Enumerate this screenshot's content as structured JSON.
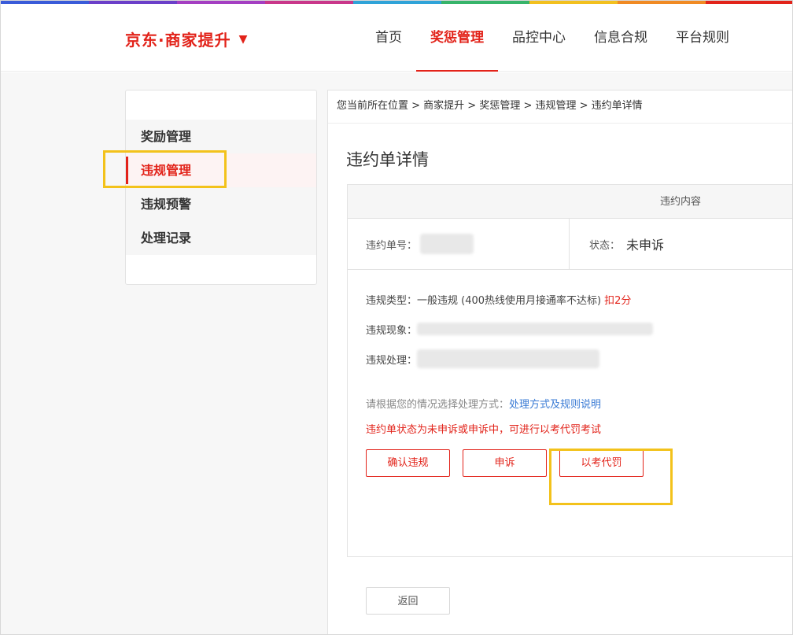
{
  "header": {
    "brand": "京东·商家提升",
    "nav": [
      {
        "label": "首页",
        "active": false
      },
      {
        "label": "奖惩管理",
        "active": true
      },
      {
        "label": "品控中心",
        "active": false
      },
      {
        "label": "信息合规",
        "active": false
      },
      {
        "label": "平台规则",
        "active": false
      }
    ]
  },
  "sidebar": {
    "items": [
      {
        "label": "奖励管理"
      },
      {
        "label": "违规管理"
      },
      {
        "label": "违规预警"
      },
      {
        "label": "处理记录"
      }
    ]
  },
  "breadcrumb": "您当前所在位置 > 商家提升 > 奖惩管理 > 违规管理 > 违约单详情",
  "page_title": "违约单详情",
  "panel": {
    "header": "违约内容",
    "order_no_label": "违约单号：",
    "status_label": "状态：",
    "status_value": "未申诉",
    "violation_type_label": "违规类型：",
    "violation_type_value": "一般违规 (400热线使用月接通率不达标)",
    "deduct": "扣2分",
    "phenomenon_label": "违规现象：",
    "handling_label": "违规处理：",
    "choose_text": "请根据您的情况选择处理方式：",
    "choose_link": "处理方式及规则说明",
    "warn_text": "违约单状态为未申诉或申诉中，可进行以考代罚考试",
    "buttons": {
      "confirm": "确认违规",
      "appeal": "申诉",
      "exam": "以考代罚"
    }
  },
  "back_button": "返回",
  "colors": {
    "accent": "#e2231a",
    "highlight": "#f3c21b",
    "link": "#3a7bd5"
  }
}
